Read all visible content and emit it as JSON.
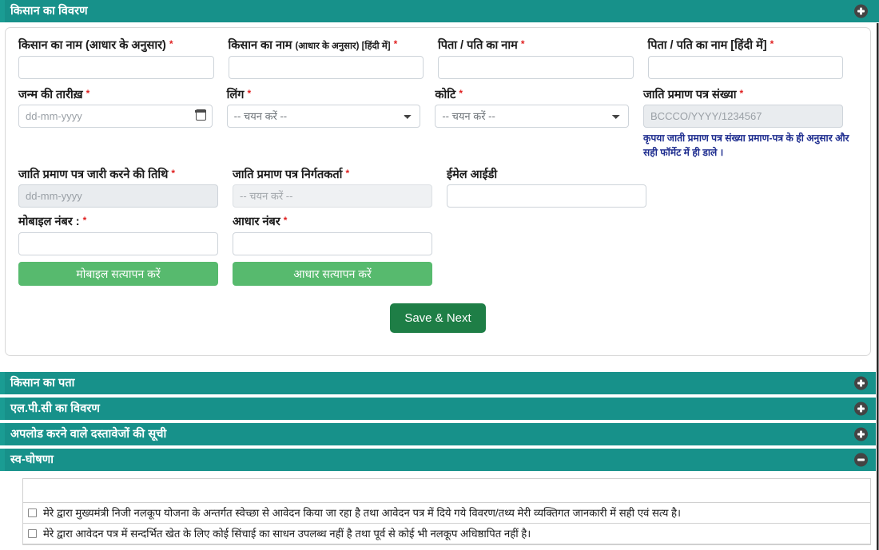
{
  "theme": {
    "accordion_bg": "#17918a",
    "accordion_accent": "#1a9c93",
    "verify_button_bg": "#57ba6e",
    "save_button_bg": "#1e7e46",
    "hint_color": "#1e2d8f",
    "required_color": "#e02020",
    "disabled_bg": "#e9ecef"
  },
  "sections": {
    "farmer_details": {
      "title": "किसान का विवरण",
      "toggle_icon": "minus-icon",
      "expanded": true
    },
    "farmer_address": {
      "title": "किसान का पता",
      "toggle_icon": "plus-icon",
      "expanded": false
    },
    "lpc_details": {
      "title": "एल.पी.सी का विवरण",
      "toggle_icon": "plus-icon",
      "expanded": false
    },
    "documents_list": {
      "title": "अपलोड करने वाले दस्तावेजों की सूची",
      "toggle_icon": "plus-icon",
      "expanded": false
    },
    "self_declaration": {
      "title": "स्व-घोषणा",
      "toggle_icon": "minus-icon",
      "expanded": true
    }
  },
  "form": {
    "farmer_name": {
      "label": "किसान का नाम (आधार के अनुसार)",
      "required": "*",
      "value": "",
      "placeholder": ""
    },
    "farmer_name_hindi": {
      "label_main": "किसान का नाम ",
      "label_sub": "(आधार के अनुसार) [हिंदी में]",
      "required": "*",
      "value": "",
      "placeholder": ""
    },
    "father_husband_name": {
      "label": "पिता / पति का नाम",
      "required": "*",
      "value": "",
      "placeholder": ""
    },
    "father_husband_name_hindi": {
      "label": "पिता / पति का नाम [हिंदी में]",
      "required": "*",
      "value": "",
      "placeholder": ""
    },
    "dob": {
      "label": "जन्म की तारीख़",
      "required": "*",
      "value": "",
      "placeholder": "dd-mm-yyyy",
      "icon": "calendar-icon"
    },
    "gender": {
      "label": "लिंग",
      "required": "*",
      "selected": "-- चयन करें --"
    },
    "category": {
      "label": "कोटि",
      "required": "*",
      "selected": "-- चयन करें --"
    },
    "caste_cert_no": {
      "label": "जाति प्रमाण पत्र संख्या",
      "required": "*",
      "value": "",
      "placeholder": "BCCCO/YYYY/1234567",
      "disabled": true
    },
    "caste_cert_hint": "कृपया जाती प्रमाण पत्र संख्या प्रमाण-पत्र के ही अनुसार और सही फॉर्मेट में ही डाले ।",
    "caste_cert_issue_date": {
      "label": "जाति प्रमाण पत्र जारी करने की तिथि",
      "required": "*",
      "value": "",
      "placeholder": "dd-mm-yyyy",
      "disabled": true
    },
    "caste_cert_issuer": {
      "label": "जाति प्रमाण पत्र निर्गतकर्ता",
      "required": "*",
      "selected": "-- चयन करें --",
      "disabled": true
    },
    "email": {
      "label": "ईमेल आईडी",
      "required": "",
      "value": "",
      "placeholder": ""
    },
    "mobile": {
      "label": "मोबाइल नंबर :",
      "required": "*",
      "value": "",
      "placeholder": ""
    },
    "aadhaar": {
      "label": "आधार नंबर",
      "required": "*",
      "value": "",
      "placeholder": ""
    },
    "verify_mobile_button": "मोबाइल सत्यापन करें",
    "verify_aadhaar_button": "आधार सत्यापन करें",
    "save_next_button": "Save & Next"
  },
  "declaration": {
    "items": [
      {
        "checked": false,
        "text": "मेरे द्वारा मुख्यमंत्री निजी नलकूप योजना के अन्तर्गत स्वेच्छा से आवेदन किया जा रहा है तथा आवेदन पत्र में दिये गये विवरण/तथ्य मेरी व्यक्तिगत जानकारी में सही एवं सत्य है।"
      },
      {
        "checked": false,
        "text": "मेरे द्वारा आवेदन पत्र में सन्दर्भित खेत के लिए कोई सिंचाई का साधन उपलब्ध नहीं है तथा पूर्व से कोई भी नलकूप अधिष्ठापित नहीं है।"
      }
    ]
  }
}
